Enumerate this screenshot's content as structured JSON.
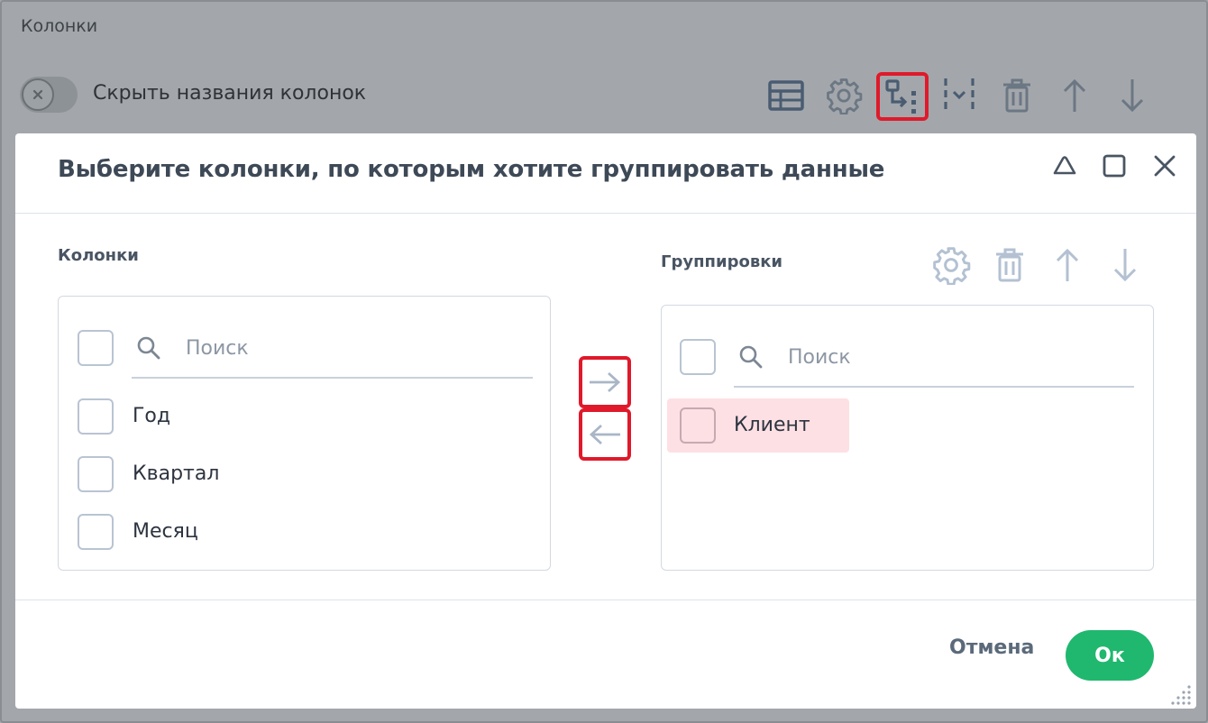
{
  "background": {
    "section_title": "Колонки",
    "toggle_label": "Скрыть названия колонок",
    "toolbar_icons": [
      "table-icon",
      "gear-icon",
      "group-icon",
      "split-columns-icon",
      "trash-icon",
      "arrow-up-icon",
      "arrow-down-icon"
    ]
  },
  "dialog": {
    "title": "Выберите колонки, по которым хотите группировать данные",
    "window_icons": [
      "collapse-icon",
      "maximize-icon",
      "close-icon"
    ],
    "columns_panel": {
      "label": "Колонки",
      "search_placeholder": "Поиск",
      "items": [
        {
          "label": "Год"
        },
        {
          "label": "Квартал"
        },
        {
          "label": "Месяц"
        }
      ]
    },
    "groupings_panel": {
      "label": "Группировки",
      "search_placeholder": "Поиск",
      "items": [
        {
          "label": "Клиент",
          "selected": true
        }
      ]
    },
    "footer": {
      "cancel_label": "Отмена",
      "ok_label": "Ок"
    }
  },
  "colors": {
    "accent_highlight": "#e0192b",
    "ok_green": "#1fb86e",
    "selected_row": "#fde0e4",
    "overlay": "#a3a7ab"
  }
}
